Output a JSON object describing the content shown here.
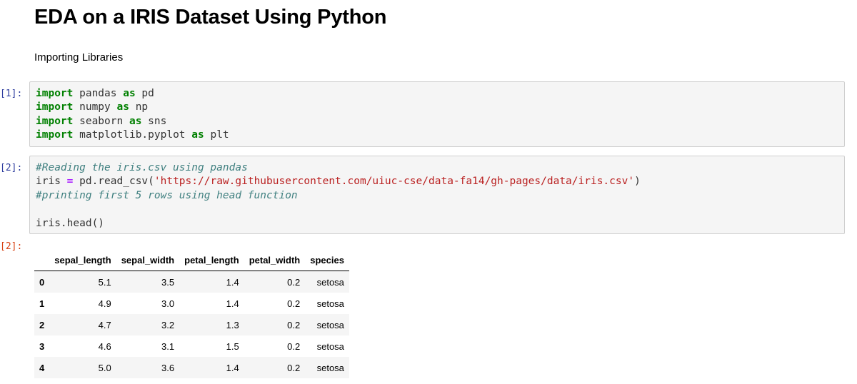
{
  "notebook": {
    "title": "EDA on a IRIS Dataset Using Python",
    "markdown_text": "Importing Libraries",
    "cells": [
      {
        "prompt": "[1]:",
        "lines": [
          [
            [
              "kw",
              "import"
            ],
            [
              "plain",
              " pandas "
            ],
            [
              "kw",
              "as"
            ],
            [
              "plain",
              " pd"
            ]
          ],
          [
            [
              "kw",
              "import"
            ],
            [
              "plain",
              " numpy "
            ],
            [
              "kw",
              "as"
            ],
            [
              "plain",
              " np"
            ]
          ],
          [
            [
              "kw",
              "import"
            ],
            [
              "plain",
              " seaborn "
            ],
            [
              "kw",
              "as"
            ],
            [
              "plain",
              " sns"
            ]
          ],
          [
            [
              "kw",
              "import"
            ],
            [
              "plain",
              " matplotlib.pyplot "
            ],
            [
              "kw",
              "as"
            ],
            [
              "plain",
              " plt"
            ]
          ]
        ]
      },
      {
        "prompt": "[2]:",
        "lines": [
          [
            [
              "cm",
              "#Reading the iris.csv using pandas"
            ]
          ],
          [
            [
              "plain",
              "iris "
            ],
            [
              "op",
              "="
            ],
            [
              "plain",
              " pd.read_csv("
            ],
            [
              "str",
              "'https://raw.githubusercontent.com/uiuc-cse/data-fa14/gh-pages/data/iris.csv'"
            ],
            [
              "plain",
              ")"
            ]
          ],
          [
            [
              "cm",
              "#printing first 5 rows using head function"
            ]
          ],
          [
            [
              "plain",
              ""
            ]
          ],
          [
            [
              "plain",
              "iris.head()"
            ]
          ]
        ]
      }
    ],
    "output": {
      "prompt": "[2]:",
      "columns": [
        "sepal_length",
        "sepal_width",
        "petal_length",
        "petal_width",
        "species"
      ],
      "rows": [
        {
          "index": "0",
          "values": [
            "5.1",
            "3.5",
            "1.4",
            "0.2",
            "setosa"
          ]
        },
        {
          "index": "1",
          "values": [
            "4.9",
            "3.0",
            "1.4",
            "0.2",
            "setosa"
          ]
        },
        {
          "index": "2",
          "values": [
            "4.7",
            "3.2",
            "1.3",
            "0.2",
            "setosa"
          ]
        },
        {
          "index": "3",
          "values": [
            "4.6",
            "3.1",
            "1.5",
            "0.2",
            "setosa"
          ]
        },
        {
          "index": "4",
          "values": [
            "5.0",
            "3.6",
            "1.4",
            "0.2",
            "setosa"
          ]
        }
      ]
    }
  }
}
